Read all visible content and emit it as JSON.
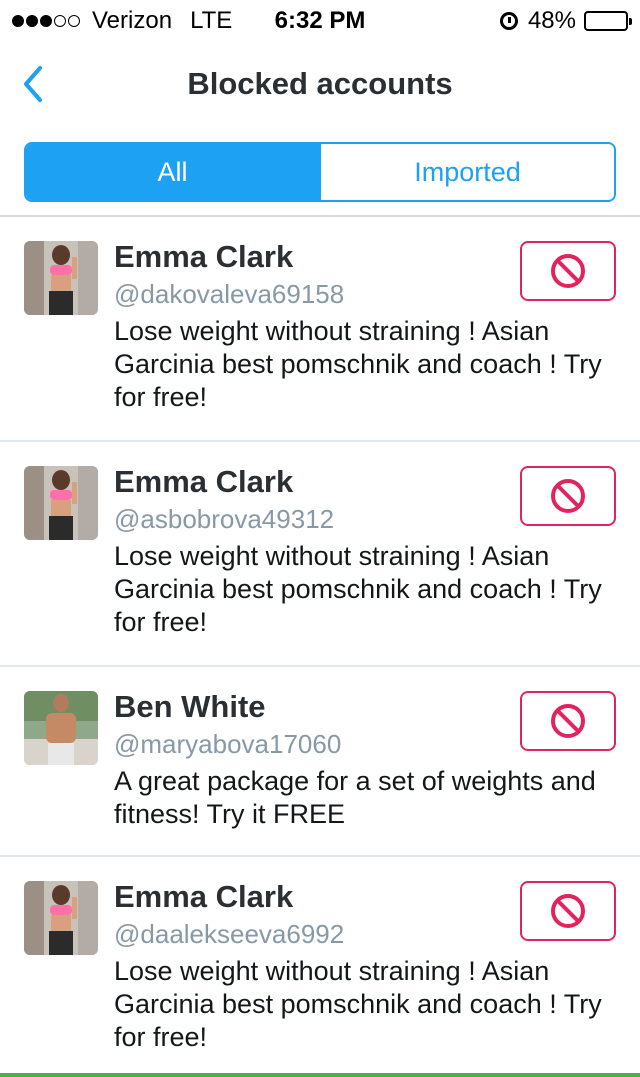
{
  "status_bar": {
    "carrier": "Verizon",
    "network": "LTE",
    "time": "6:32 PM",
    "battery_percent": "48%",
    "battery_level": 0.48,
    "signal_bars_filled": 3,
    "signal_bars_total": 5
  },
  "nav": {
    "title": "Blocked accounts",
    "back_icon": "chevron-left-icon"
  },
  "tabs": [
    {
      "label": "All",
      "active": true
    },
    {
      "label": "Imported",
      "active": false
    }
  ],
  "colors": {
    "accent": "#1da1f2",
    "block_red": "#e0245e",
    "handle_gray": "#8899a6"
  },
  "accounts": [
    {
      "name": "Emma Clark",
      "handle": "@dakovaleva69158",
      "bio": "Lose weight without straining ! Asian Garcinia best pomschnik and coach ! Try for free!",
      "blocked_icon": "blocked-icon"
    },
    {
      "name": "Emma Clark",
      "handle": "@asbobrova49312",
      "bio": "Lose weight without straining ! Asian Garcinia best pomschnik and coach ! Try for free!",
      "blocked_icon": "blocked-icon"
    },
    {
      "name": "Ben White",
      "handle": "@maryabova17060",
      "bio": "A great package for a set of weights and fitness! Try it FREE",
      "blocked_icon": "blocked-icon"
    },
    {
      "name": "Emma Clark",
      "handle": "@daalekseeva6992",
      "bio": "Lose weight without straining ! Asian Garcinia best pomschnik and coach ! Try for free!",
      "blocked_icon": "blocked-icon"
    }
  ]
}
